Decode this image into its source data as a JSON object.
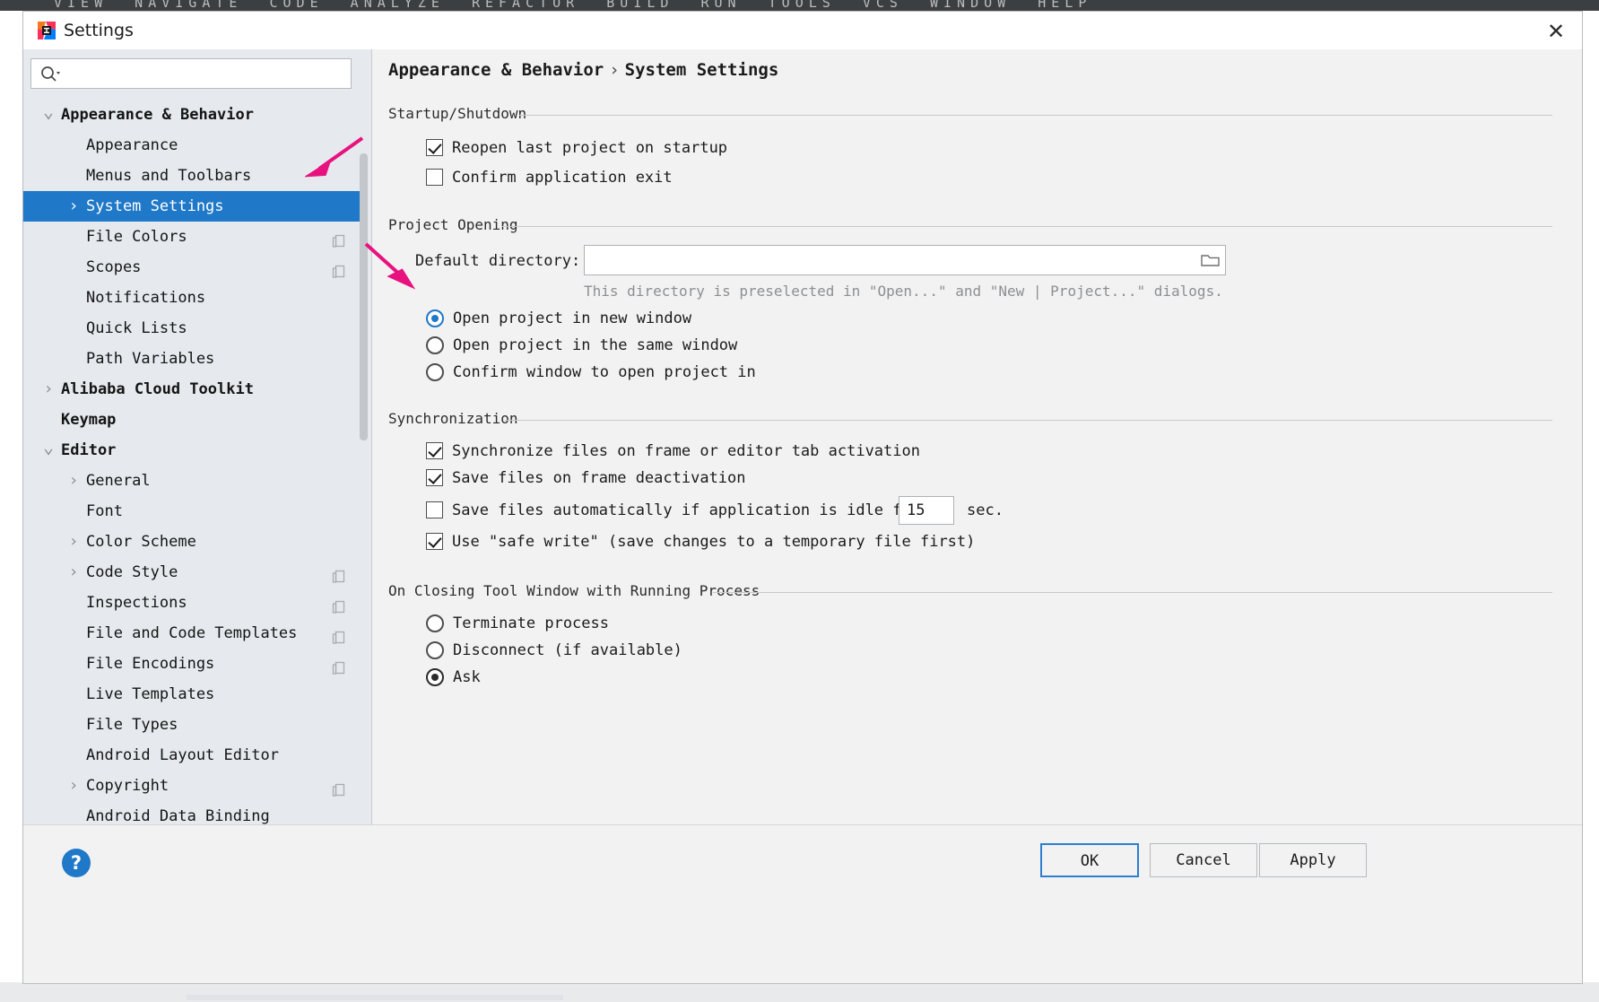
{
  "window": {
    "title": "Settings",
    "app_icon": "intellij-idea-icon",
    "close_icon": "close-icon"
  },
  "search": {
    "placeholder": "",
    "value": "",
    "icon": "search-icon"
  },
  "sidebar": {
    "items": [
      {
        "label": "Appearance & Behavior",
        "indent": 0,
        "twisty": "expanded",
        "bold": true,
        "selected": false,
        "badge": false
      },
      {
        "label": "Appearance",
        "indent": 1,
        "twisty": "none",
        "bold": false,
        "selected": false,
        "badge": false
      },
      {
        "label": "Menus and Toolbars",
        "indent": 1,
        "twisty": "none",
        "bold": false,
        "selected": false,
        "badge": false
      },
      {
        "label": "System Settings",
        "indent": 1,
        "twisty": "collapsed",
        "bold": false,
        "selected": true,
        "badge": false
      },
      {
        "label": "File Colors",
        "indent": 1,
        "twisty": "none",
        "bold": false,
        "selected": false,
        "badge": true
      },
      {
        "label": "Scopes",
        "indent": 1,
        "twisty": "none",
        "bold": false,
        "selected": false,
        "badge": true
      },
      {
        "label": "Notifications",
        "indent": 1,
        "twisty": "none",
        "bold": false,
        "selected": false,
        "badge": false
      },
      {
        "label": "Quick Lists",
        "indent": 1,
        "twisty": "none",
        "bold": false,
        "selected": false,
        "badge": false
      },
      {
        "label": "Path Variables",
        "indent": 1,
        "twisty": "none",
        "bold": false,
        "selected": false,
        "badge": false
      },
      {
        "label": "Alibaba Cloud Toolkit",
        "indent": 0,
        "twisty": "collapsed",
        "bold": true,
        "selected": false,
        "badge": false
      },
      {
        "label": "Keymap",
        "indent": 0,
        "twisty": "none",
        "bold": true,
        "selected": false,
        "badge": false
      },
      {
        "label": "Editor",
        "indent": 0,
        "twisty": "expanded",
        "bold": true,
        "selected": false,
        "badge": false
      },
      {
        "label": "General",
        "indent": 1,
        "twisty": "collapsed",
        "bold": false,
        "selected": false,
        "badge": false
      },
      {
        "label": "Font",
        "indent": 1,
        "twisty": "none",
        "bold": false,
        "selected": false,
        "badge": false
      },
      {
        "label": "Color Scheme",
        "indent": 1,
        "twisty": "collapsed",
        "bold": false,
        "selected": false,
        "badge": false
      },
      {
        "label": "Code Style",
        "indent": 1,
        "twisty": "collapsed",
        "bold": false,
        "selected": false,
        "badge": true
      },
      {
        "label": "Inspections",
        "indent": 1,
        "twisty": "none",
        "bold": false,
        "selected": false,
        "badge": true
      },
      {
        "label": "File and Code Templates",
        "indent": 1,
        "twisty": "none",
        "bold": false,
        "selected": false,
        "badge": true
      },
      {
        "label": "File Encodings",
        "indent": 1,
        "twisty": "none",
        "bold": false,
        "selected": false,
        "badge": true
      },
      {
        "label": "Live Templates",
        "indent": 1,
        "twisty": "none",
        "bold": false,
        "selected": false,
        "badge": false
      },
      {
        "label": "File Types",
        "indent": 1,
        "twisty": "none",
        "bold": false,
        "selected": false,
        "badge": false
      },
      {
        "label": "Android Layout Editor",
        "indent": 1,
        "twisty": "none",
        "bold": false,
        "selected": false,
        "badge": false
      },
      {
        "label": "Copyright",
        "indent": 1,
        "twisty": "collapsed",
        "bold": false,
        "selected": false,
        "badge": true
      },
      {
        "label": "Android Data Binding",
        "indent": 1,
        "twisty": "none",
        "bold": false,
        "selected": false,
        "badge": false
      }
    ]
  },
  "breadcrumb": {
    "root": "Appearance & Behavior",
    "separator": "›",
    "leaf": "System Settings"
  },
  "startup": {
    "section_title": "Startup/Shutdown",
    "reopen_label": "Reopen last project on startup",
    "confirm_exit_label": "Confirm application exit"
  },
  "project_opening": {
    "section_title": "Project Opening",
    "default_directory_label": "Default directory:",
    "default_directory_value": "",
    "browse_icon": "folder-icon",
    "hint": "This directory is preselected in \"Open...\" and \"New | Project...\" dialogs.",
    "options": [
      {
        "label": "Open project in new window",
        "selected": true
      },
      {
        "label": "Open project in the same window",
        "selected": false
      },
      {
        "label": "Confirm window to open project in",
        "selected": false
      }
    ]
  },
  "synchronization": {
    "section_title": "Synchronization",
    "sync_on_activation_label": "Synchronize files on frame or editor tab activation",
    "save_on_deactivation_label": "Save files on frame deactivation",
    "save_idle_label": "Save files automatically if application is idle for",
    "idle_seconds": "15",
    "idle_unit": "sec.",
    "safe_write_label": "Use \"safe write\" (save changes to a temporary file first)"
  },
  "closing_tool_window": {
    "section_title": "On Closing Tool Window with Running Process",
    "options": [
      {
        "label": "Terminate process",
        "selected": false
      },
      {
        "label": "Disconnect (if available)",
        "selected": false
      },
      {
        "label": "Ask",
        "selected": true
      }
    ]
  },
  "footer": {
    "help_icon": "help-icon",
    "ok_label": "OK",
    "cancel_label": "Cancel",
    "apply_label": "Apply"
  },
  "annotations": {
    "arrow_color": "#e8127f",
    "arrows": [
      "arrow-to-system-settings",
      "arrow-to-default-directory"
    ]
  },
  "colors": {
    "accent": "#1f78c8",
    "selection": "#1f78c8",
    "dialog_bg": "#f2f2f2",
    "sidebar_bg": "#e6eaee",
    "annotation": "#e8127f"
  }
}
